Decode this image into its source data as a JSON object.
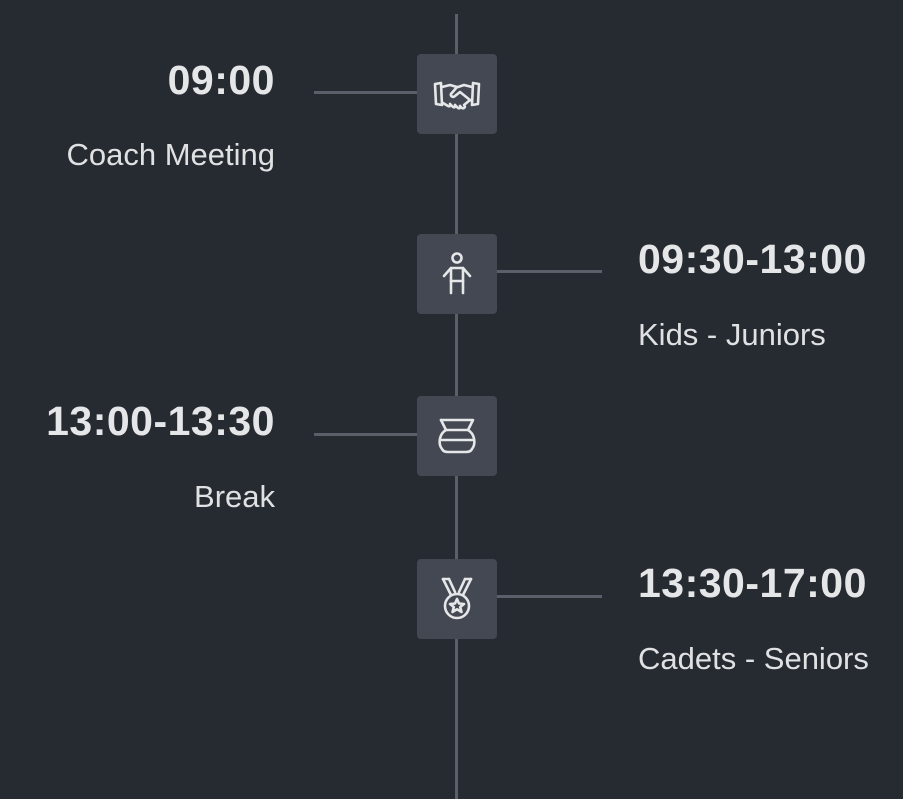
{
  "theme": {
    "background": "#262a31",
    "line": "#5a5f69",
    "icon_box": "#434852",
    "text": "#e2e3e5"
  },
  "events": [
    {
      "time": "09:00",
      "title": "Coach Meeting",
      "icon": "handshake-icon",
      "side": "left"
    },
    {
      "time": "09:30-13:00",
      "title": "Kids - Juniors",
      "icon": "person-icon",
      "side": "right"
    },
    {
      "time": "13:00-13:30",
      "title": "Break",
      "icon": "coffee-pot-icon",
      "side": "left"
    },
    {
      "time": "13:30-17:00",
      "title": "Cadets - Seniors",
      "icon": "medal-icon",
      "side": "right"
    }
  ]
}
